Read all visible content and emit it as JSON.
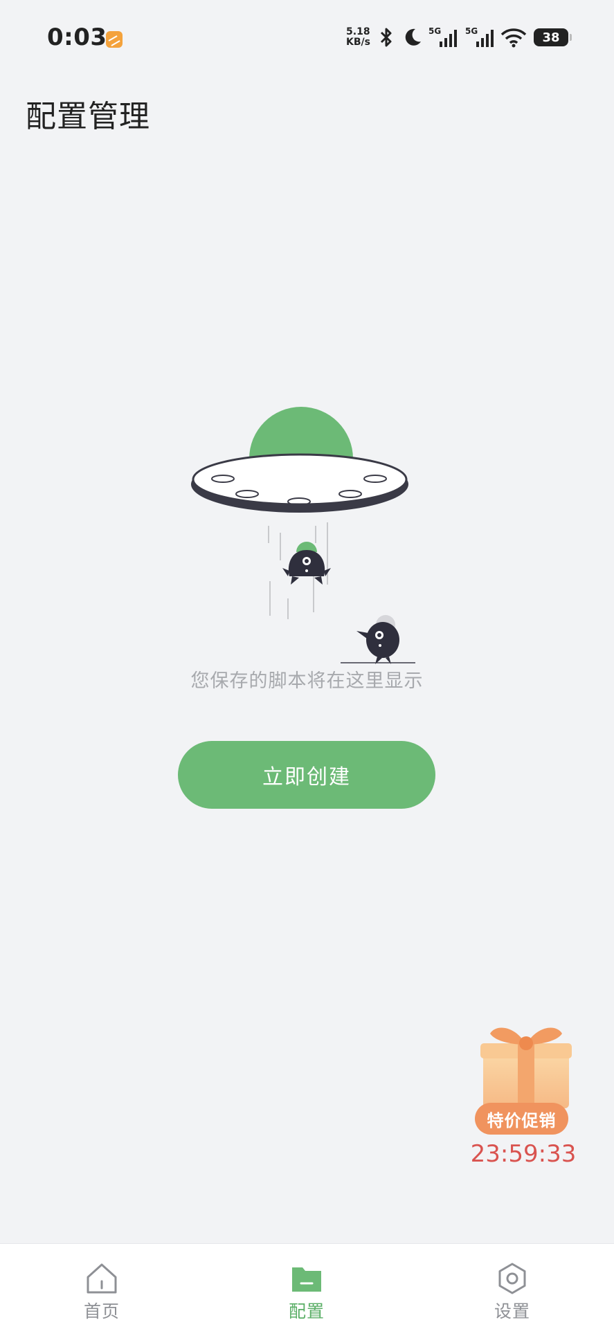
{
  "status_bar": {
    "time": "0:03",
    "net_speed_value": "5.18",
    "net_speed_unit": "KB/s",
    "signal_1_tag": "5G",
    "signal_2_tag": "5G",
    "battery": "38"
  },
  "header": {
    "title": "配置管理"
  },
  "empty_state": {
    "message": "您保存的脚本将在这里显示",
    "create_button_label": "立即创建"
  },
  "promo": {
    "badge_label": "特价促销",
    "countdown": "23:59:33"
  },
  "bottom_nav": {
    "items": [
      {
        "label": "首页",
        "icon": "home-icon"
      },
      {
        "label": "配置",
        "icon": "folder-icon",
        "active": true
      },
      {
        "label": "设置",
        "icon": "gear-icon"
      }
    ]
  },
  "colors": {
    "accent": "#6cba76",
    "background": "#f2f3f5",
    "promo": "#f0935e",
    "countdown": "#d9534f"
  }
}
